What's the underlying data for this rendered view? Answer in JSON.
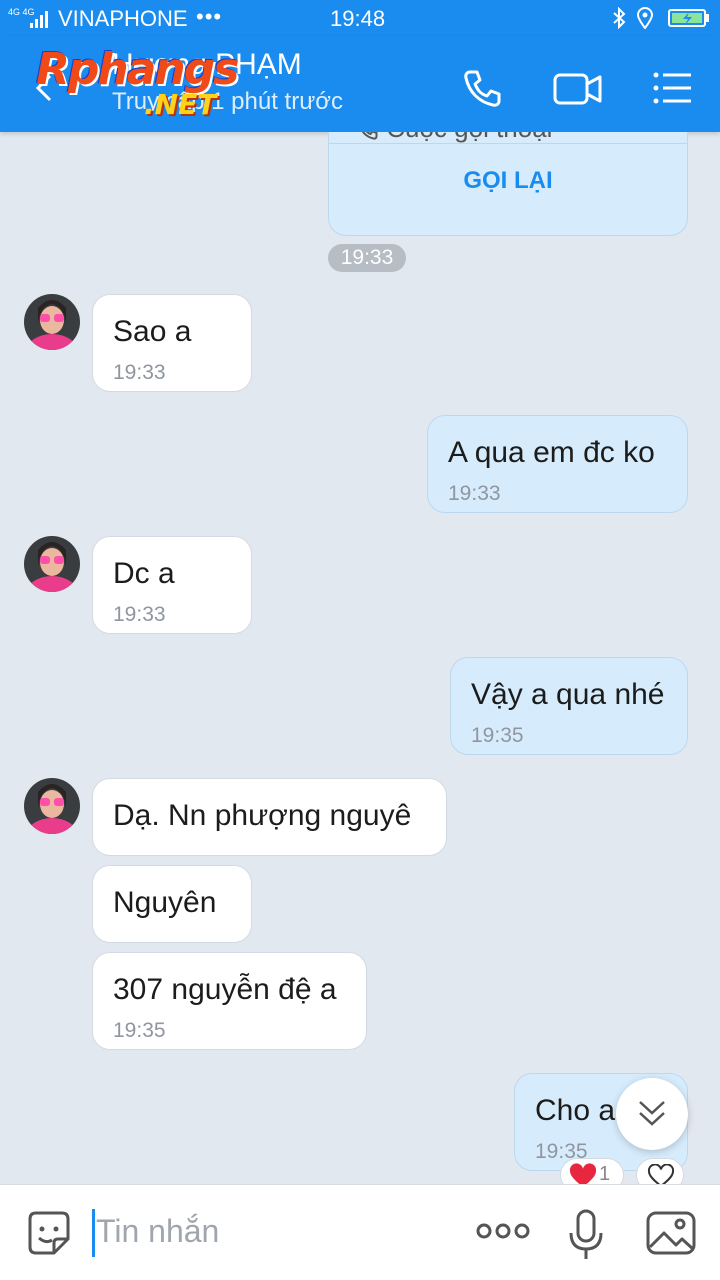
{
  "status_bar": {
    "network": "4G 4G",
    "carrier": "VINAPHONE",
    "dots": "•••",
    "time": "19:48"
  },
  "header": {
    "contact_name": "Hương PHẠM",
    "last_seen": "Truy cập 1 phút trước",
    "watermark_main": "Rphangs",
    "watermark_sub": ".NET"
  },
  "call_card": {
    "type": "Cuộc gọi thoại",
    "action": "GỌI LẠI",
    "time": "19:33"
  },
  "messages": [
    {
      "dir": "in",
      "text": "Sao a",
      "time": "19:33"
    },
    {
      "dir": "out",
      "text": "A qua em đc ko",
      "time": "19:33"
    },
    {
      "dir": "in",
      "text": "Dc a",
      "time": "19:33"
    },
    {
      "dir": "out",
      "text": "Vậy a qua nhé",
      "time": "19:35"
    },
    {
      "dir": "in",
      "text": "Dạ. Nn phượng nguyê",
      "time": ""
    },
    {
      "dir": "in",
      "text": "Nguyên",
      "time": ""
    },
    {
      "dir": "in",
      "text": "307 nguyễn đệ a",
      "time": "19:35"
    },
    {
      "dir": "out",
      "text": "Cho a",
      "time": "19:35"
    }
  ],
  "reactions": {
    "heart_count": "1"
  },
  "input": {
    "placeholder": "Tin nhắn"
  },
  "colors": {
    "accent": "#1a8cf0",
    "incoming": "#ffffff",
    "outgoing": "#d6ecfc",
    "background": "#e2e8f0"
  }
}
